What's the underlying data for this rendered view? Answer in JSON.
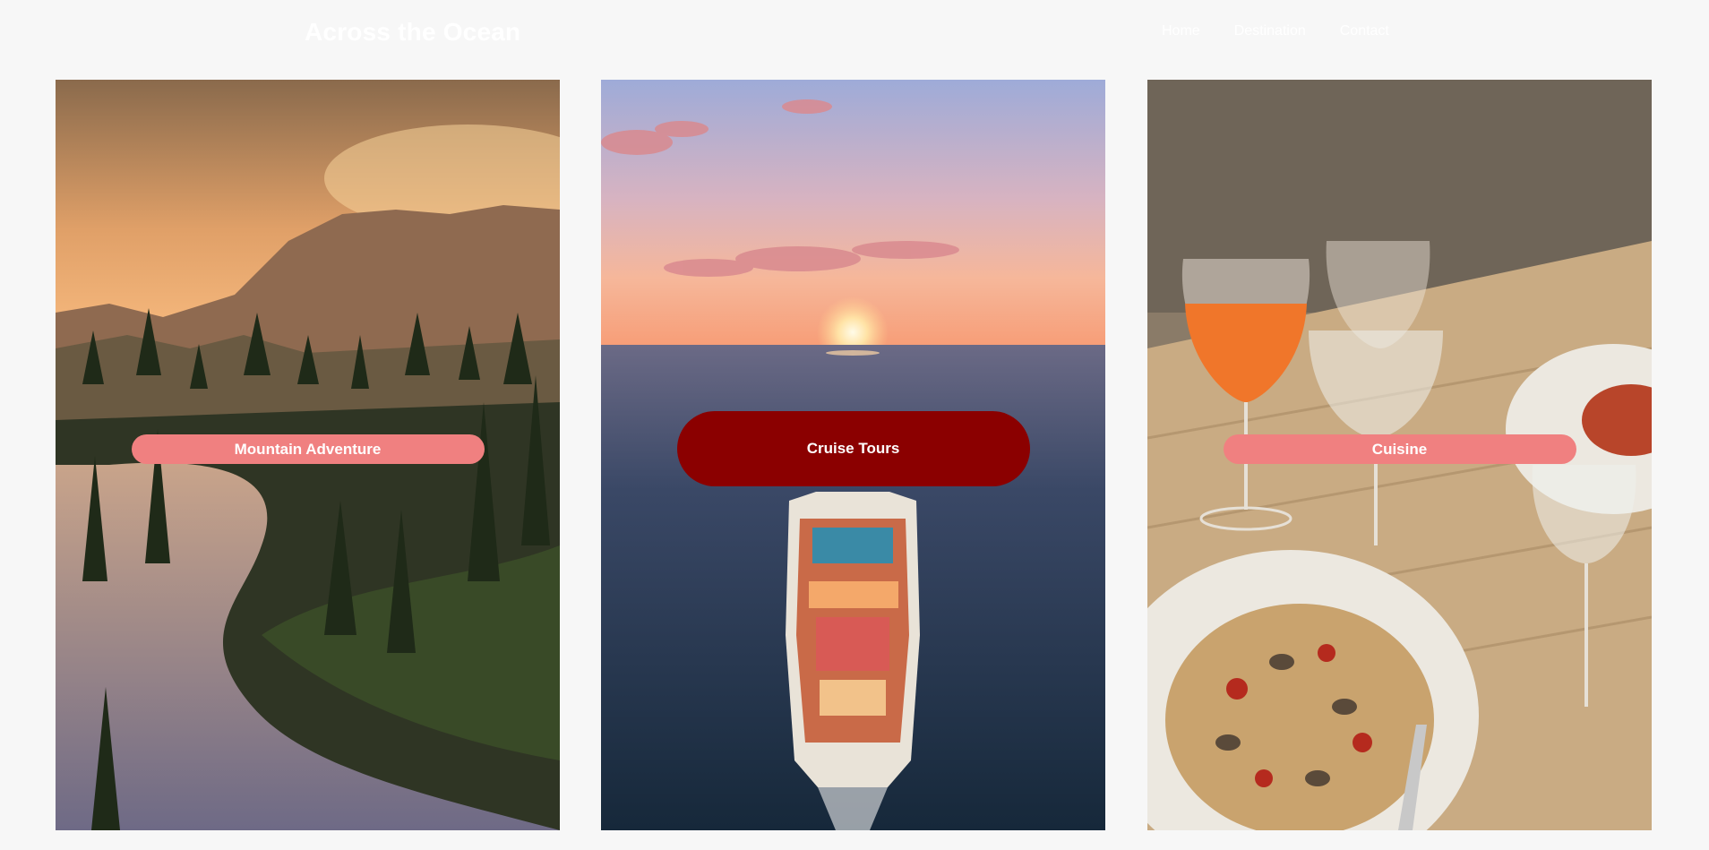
{
  "header": {
    "site_title": "Across the Ocean",
    "nav": [
      "Home",
      "Destination",
      "Contact"
    ]
  },
  "cards": [
    {
      "label": "Mountain Adventure",
      "image": "mountain-lake-sunset",
      "button_color": "#f08080"
    },
    {
      "label": "Cruise Tours",
      "image": "cruise-ship-ocean-sunset",
      "button_color": "#8b0000"
    },
    {
      "label": "Cuisine",
      "image": "pasta-and-wine-table",
      "button_color": "#f08080"
    }
  ],
  "colors": {
    "page_background": "#f7f7f7",
    "button_default": "#f08080",
    "button_active": "#8b0000",
    "text": "#ffffff"
  }
}
